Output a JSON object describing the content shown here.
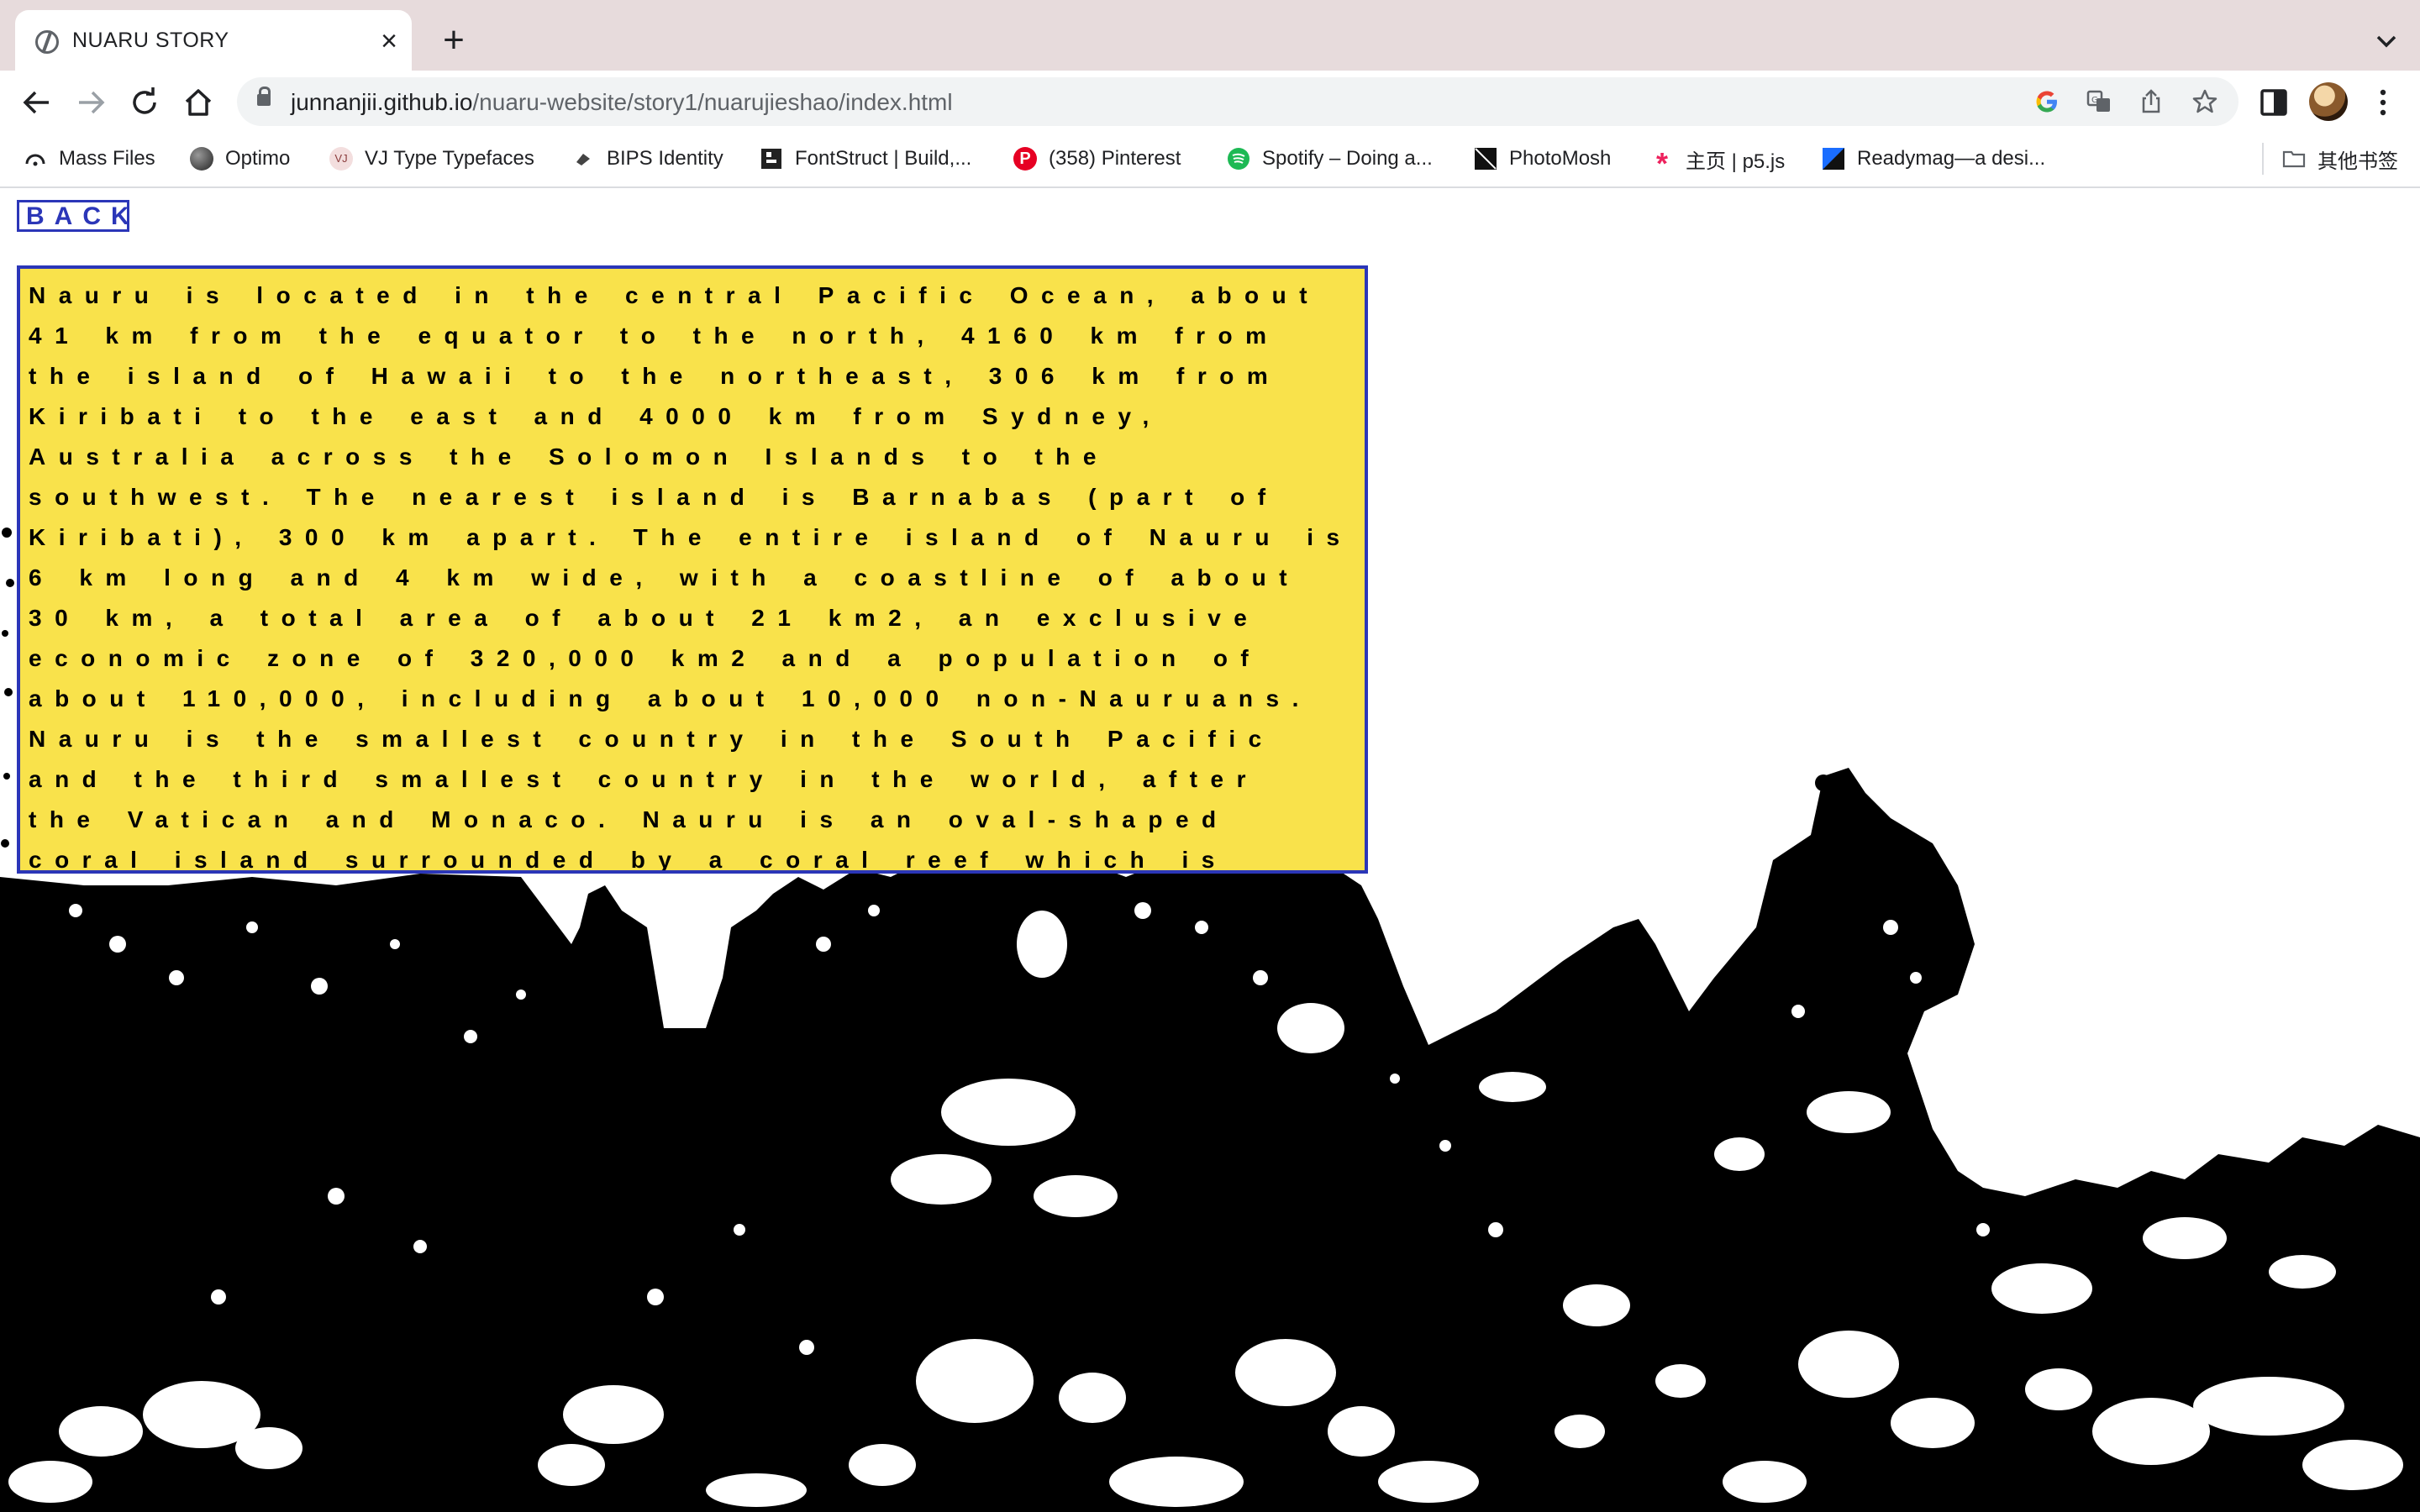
{
  "browser": {
    "tab_title": "NUARU STORY",
    "url_domain": "junnanjii.github.io",
    "url_path": "/nuaru-website/story1/nuarujieshao/index.html",
    "bookmarks": [
      {
        "label": "Mass Files",
        "icon": "mass-files-icon",
        "color": "#202124"
      },
      {
        "label": "Optimo",
        "icon": "optimo-icon",
        "color": "#333333"
      },
      {
        "label": "VJ Type Typefaces",
        "icon": "vj-type-icon",
        "color": "#d9a5a5"
      },
      {
        "label": "BIPS Identity",
        "icon": "bips-icon",
        "color": "#444444"
      },
      {
        "label": "FontStruct | Build,...",
        "icon": "fontstruct-icon",
        "color": "#222222"
      },
      {
        "label": "(358) Pinterest",
        "icon": "pinterest-icon",
        "color": "#e60023"
      },
      {
        "label": "Spotify – Doing a...",
        "icon": "spotify-icon",
        "color": "#1db954"
      },
      {
        "label": "PhotoMosh",
        "icon": "photomosh-icon",
        "color": "#111111"
      },
      {
        "label": "主页 | p5.js",
        "icon": "p5js-icon",
        "color": "#ed225d"
      },
      {
        "label": "Readymag—a desi...",
        "icon": "readymag-icon",
        "color": "#1a6dff"
      }
    ],
    "other_bookmarks": "其他书签"
  },
  "page": {
    "back_label": "BACK",
    "story": "Nauru is located in the central Pacific Ocean, about 41 km from the equator to the north, 4160 km from the island of Hawaii to the northeast, 306 km from Kiribati to the east and 4000 km from Sydney, Australia across the Solomon Islands to the southwest. The nearest island is Barnabas (part of Kiribati), 300 km apart. The entire island of Nauru is 6 km long and 4 km wide, with a coastline of about 30 km, a total area of about 21 km2, an exclusive economic zone of 320,000 km2 and a population of about 110,000, including about 10,000 non-Nauruans. Nauru is the smallest country in the South Pacific and the third smallest country in the world, after the Vatican and Monaco. Nauru is an oval-shaped coral island surrounded by a coral reef which is revealed at low tide."
  },
  "colors": {
    "accent_blue": "#2b36b8",
    "story_bg": "#f9e24b"
  }
}
